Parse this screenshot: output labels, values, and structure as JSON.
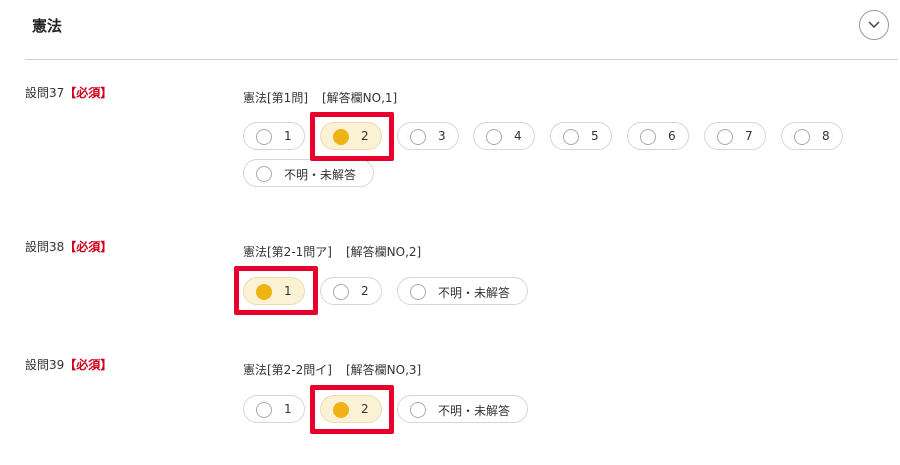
{
  "section": {
    "title": "憲法"
  },
  "questions": [
    {
      "label": "設問37",
      "required": "【必須】",
      "title": "憲法[第1問]",
      "ref": "[解答欄NO,1]",
      "options": [
        "1",
        "2",
        "3",
        "4",
        "5",
        "6",
        "7",
        "8",
        "不明・未解答"
      ],
      "selected": "2"
    },
    {
      "label": "設問38",
      "required": "【必須】",
      "title": "憲法[第2-1問ア]",
      "ref": "[解答欄NO,2]",
      "options": [
        "1",
        "2",
        "不明・未解答"
      ],
      "selected": "1"
    },
    {
      "label": "設問39",
      "required": "【必須】",
      "title": "憲法[第2-2問イ]",
      "ref": "[解答欄NO,3]",
      "options": [
        "1",
        "2",
        "不明・未解答"
      ],
      "selected": "2"
    }
  ],
  "colors": {
    "selected_dot": "#efb414",
    "selected_bg": "#fbf1d5",
    "highlight": "#e8002d",
    "required": "#d0021b"
  }
}
